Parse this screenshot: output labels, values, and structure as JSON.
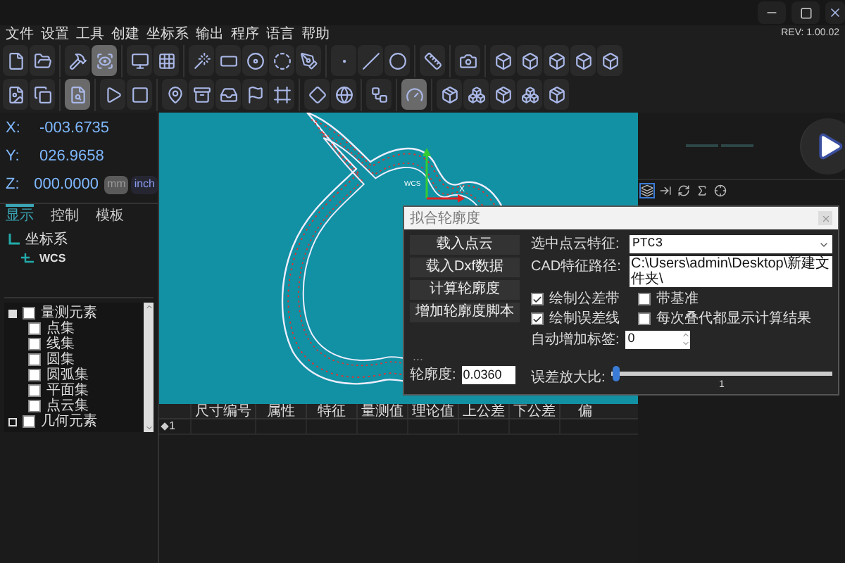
{
  "menu": [
    "文件",
    "设置",
    "工具",
    "创建",
    "坐标系",
    "输出",
    "程序",
    "语言",
    "帮助"
  ],
  "version": "REV: 1.00.02",
  "toolbar": {
    "rows": [
      {
        "groups": [
          [
            {
              "kind": "file",
              "selected": false
            },
            {
              "kind": "folder",
              "selected": false
            }
          ],
          [
            {
              "kind": "hammer",
              "selected": false
            },
            {
              "kind": "scan",
              "selected": true
            }
          ],
          [
            {
              "kind": "monitor",
              "selected": false
            },
            {
              "kind": "grid",
              "selected": false
            }
          ],
          [
            {
              "kind": "wand",
              "selected": false
            },
            {
              "kind": "rectangle",
              "selected": false
            },
            {
              "kind": "disc",
              "selected": false
            },
            {
              "kind": "dashed",
              "selected": false
            },
            {
              "kind": "pen",
              "selected": false
            }
          ],
          [
            {
              "kind": "dot",
              "selected": false
            },
            {
              "kind": "line",
              "selected": false
            },
            {
              "kind": "circle",
              "selected": false
            }
          ],
          [
            {
              "kind": "ruler",
              "selected": false
            }
          ],
          [
            {
              "kind": "camera",
              "selected": false
            }
          ],
          [
            {
              "kind": "cube",
              "selected": false
            },
            {
              "kind": "cube",
              "selected": false
            },
            {
              "kind": "cube",
              "selected": false
            },
            {
              "kind": "cube",
              "selected": false
            },
            {
              "kind": "cube",
              "selected": false
            }
          ]
        ]
      },
      {
        "groups": [
          [
            {
              "kind": "image",
              "selected": false
            },
            {
              "kind": "copy",
              "selected": false
            }
          ],
          [
            {
              "kind": "search",
              "selected": true
            }
          ],
          [
            {
              "kind": "play",
              "selected": false
            },
            {
              "kind": "stop",
              "selected": false
            }
          ],
          [
            {
              "kind": "pin",
              "selected": false
            },
            {
              "kind": "archive",
              "selected": false
            },
            {
              "kind": "tray",
              "selected": false
            },
            {
              "kind": "flag",
              "selected": false
            },
            {
              "kind": "frame",
              "selected": false
            }
          ],
          [
            {
              "kind": "diamond",
              "selected": false
            },
            {
              "kind": "globe",
              "selected": false
            }
          ],
          [
            {
              "kind": "nodes",
              "selected": false
            }
          ],
          [
            {
              "kind": "gauge",
              "selected": true
            }
          ],
          [
            {
              "kind": "package",
              "selected": false
            },
            {
              "kind": "boxes",
              "selected": false
            },
            {
              "kind": "package",
              "selected": false
            },
            {
              "kind": "boxes",
              "selected": false
            },
            {
              "kind": "package",
              "selected": false
            }
          ]
        ]
      }
    ]
  },
  "coordinates": [
    {
      "axis": "X:",
      "value": "-003.6735"
    },
    {
      "axis": "Y:",
      "value": "026.9658"
    },
    {
      "axis": "Z:",
      "value": "000.0000"
    }
  ],
  "units": [
    {
      "label": "mm",
      "selected": true
    },
    {
      "label": "inch",
      "selected": false
    }
  ],
  "panel_tabs": [
    {
      "label": "显示",
      "selected": true
    },
    {
      "label": "控制",
      "selected": false
    },
    {
      "label": "模板",
      "selected": false
    }
  ],
  "coordinate_tree": [
    {
      "label": "坐标系",
      "children": [
        {
          "label": "WCS"
        }
      ]
    }
  ],
  "element_tree": [
    {
      "label": "量测元素",
      "checked": false,
      "expanded": true,
      "children": [
        {
          "label": "点集",
          "checked": false
        },
        {
          "label": "线集",
          "checked": false
        },
        {
          "label": "圆集",
          "checked": false
        },
        {
          "label": "圆弧集",
          "checked": false
        },
        {
          "label": "平面集",
          "checked": false
        },
        {
          "label": "点云集",
          "checked": false
        }
      ]
    },
    {
      "label": "几何元素",
      "checked": false,
      "expanded": false
    }
  ],
  "canvas": {
    "axis_labels": [
      "WCS",
      "X"
    ]
  },
  "table": {
    "columns": [
      "尺寸编号",
      "属性",
      "特征",
      "量测值",
      "理论值",
      "上公差",
      "下公差",
      "偏"
    ],
    "rows": [
      {
        "cells": [
          "1"
        ]
      }
    ]
  },
  "right_panel": {
    "tools": [
      {
        "kind": "layers",
        "selected": true
      },
      {
        "kind": "arrow",
        "selected": false
      },
      {
        "kind": "refresh",
        "selected": false
      },
      {
        "kind": "sigma",
        "selected": false
      },
      {
        "kind": "crosshair",
        "selected": false
      }
    ]
  },
  "dialog": {
    "title": "拟合轮廓度",
    "buttons": [
      "载入点云",
      "载入Dxf数据",
      "计算轮廓度",
      "增加轮廓度脚本"
    ],
    "point_cloud": {
      "label": "选中点云特征:",
      "value": "PTC3"
    },
    "cad_path": {
      "label": "CAD特征路径:",
      "value": "C:\\Users\\admin\\Desktop\\新建文件夹\\"
    },
    "options": [
      {
        "label": "绘制公差带",
        "checked": true
      },
      {
        "label": "带基准",
        "checked": false
      },
      {
        "label": "绘制误差线",
        "checked": true
      },
      {
        "label": "每次叠代都显示计算结果",
        "checked": false
      }
    ],
    "auto_label": {
      "label": "自动增加标签:",
      "value": "0"
    },
    "ellipsis": "...",
    "profile": {
      "label": "轮廓度:",
      "value": "0.0360"
    },
    "magnify": {
      "label": "误差放大比:",
      "level": 0.02,
      "reading": "1"
    }
  }
}
